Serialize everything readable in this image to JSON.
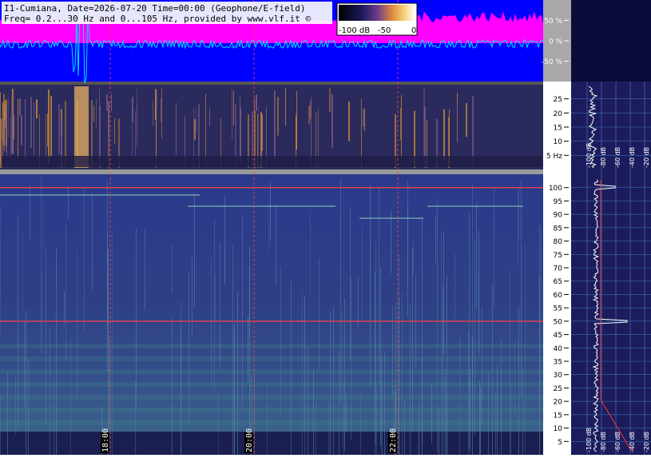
{
  "header": {
    "line1": "I1-Cumiana, Date=2026-07-20 Time=00:00 (Geophone/E-field)",
    "line2": "Freq= 0.2...30 Hz and 0...105 Hz, provided by www.vlf.it ©"
  },
  "colorbar": {
    "labels": [
      "-100 dB",
      "-50",
      "0"
    ],
    "values": [
      -100,
      -50,
      0
    ]
  },
  "panels": {
    "amplitude": {
      "ticks": [
        50,
        0,
        -50
      ],
      "tick_labels": [
        "50 %",
        "0 %",
        "-50 %"
      ],
      "ylim": [
        -100,
        100
      ]
    },
    "elf": {
      "ticks": [
        25,
        20,
        15,
        10,
        5
      ],
      "tick_labels": [
        "25",
        "20",
        "15",
        "10",
        "5 Hz"
      ],
      "ylim": [
        0.2,
        30
      ]
    },
    "spectrogram": {
      "ticks": [
        100,
        95,
        90,
        85,
        80,
        75,
        70,
        65,
        60,
        55,
        50,
        45,
        40,
        35,
        30,
        25,
        20,
        15,
        10,
        5
      ],
      "tick_labels": [
        "100",
        "95",
        "90",
        "85",
        "80",
        "75",
        "70",
        "65",
        "60",
        "55",
        "50",
        "45",
        "40",
        "35",
        "30",
        "25",
        "20",
        "15",
        "10",
        "5"
      ],
      "ylim": [
        0,
        105
      ]
    }
  },
  "chart_data": {
    "type": "heatmap",
    "time_markers": [
      {
        "label": "18:00"
      },
      {
        "label": "20:00"
      },
      {
        "label": "22:00"
      }
    ],
    "db_scale_labels": [
      "-100 dB",
      "-80 dB",
      "-60 dB",
      "-40 dB",
      "-20 dB"
    ],
    "tone_lines_hz": [
      100,
      50
    ],
    "colors": {
      "amplitude_bg": "#0000ff",
      "amplitude_band": "#ff00ff",
      "waveform": "#00e0ff",
      "marker": "#ff4040",
      "spectrogram_bg": "#2b3680"
    }
  }
}
